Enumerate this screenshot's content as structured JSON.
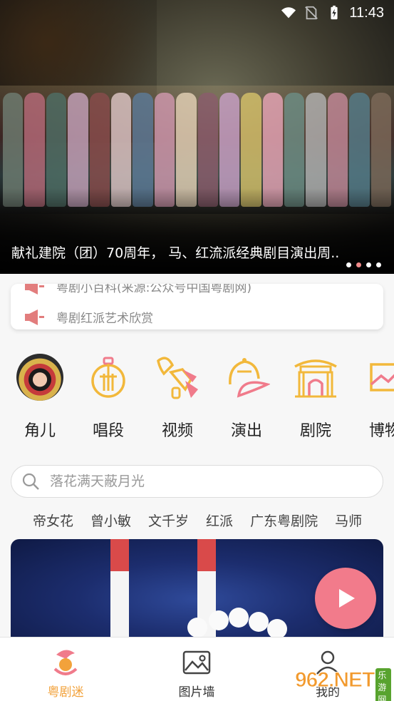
{
  "status_bar": {
    "time": "11:43"
  },
  "banner": {
    "title": "献礼建院（团）70周年， 马、红流派经典剧目演出周..",
    "dots": 4,
    "active_dot": 1
  },
  "notice": {
    "items": [
      "粤剧小百科(来源:公众号中国粤剧网)",
      "粤剧红派艺术欣赏"
    ]
  },
  "categories": [
    {
      "label": "角儿",
      "icon": "opera-actor-avatar"
    },
    {
      "label": "唱段",
      "icon": "lute-icon"
    },
    {
      "label": "视频",
      "icon": "fan-sleeve-icon"
    },
    {
      "label": "演出",
      "icon": "fan-hat-icon"
    },
    {
      "label": "剧院",
      "icon": "theater-icon"
    },
    {
      "label": "博物",
      "icon": "museum-scroll-icon"
    }
  ],
  "search": {
    "placeholder": "落花满天蔽月光"
  },
  "tags": [
    "帝女花",
    "曾小敏",
    "文千岁",
    "红派",
    "广东粤剧院",
    "马师"
  ],
  "bottom_nav": [
    {
      "label": "粤剧迷",
      "icon": "opera-fan-icon",
      "active": true
    },
    {
      "label": "图片墙",
      "icon": "picture-icon",
      "active": false
    },
    {
      "label": "我的",
      "icon": "user-icon",
      "active": false
    }
  ],
  "watermark": {
    "number": "962.NET",
    "sub": "乐游网"
  },
  "colors": {
    "accent": "#f2a23b",
    "icon_gold": "#f2b83b",
    "icon_pink": "#f07b8b",
    "play": "#f27b8b"
  }
}
